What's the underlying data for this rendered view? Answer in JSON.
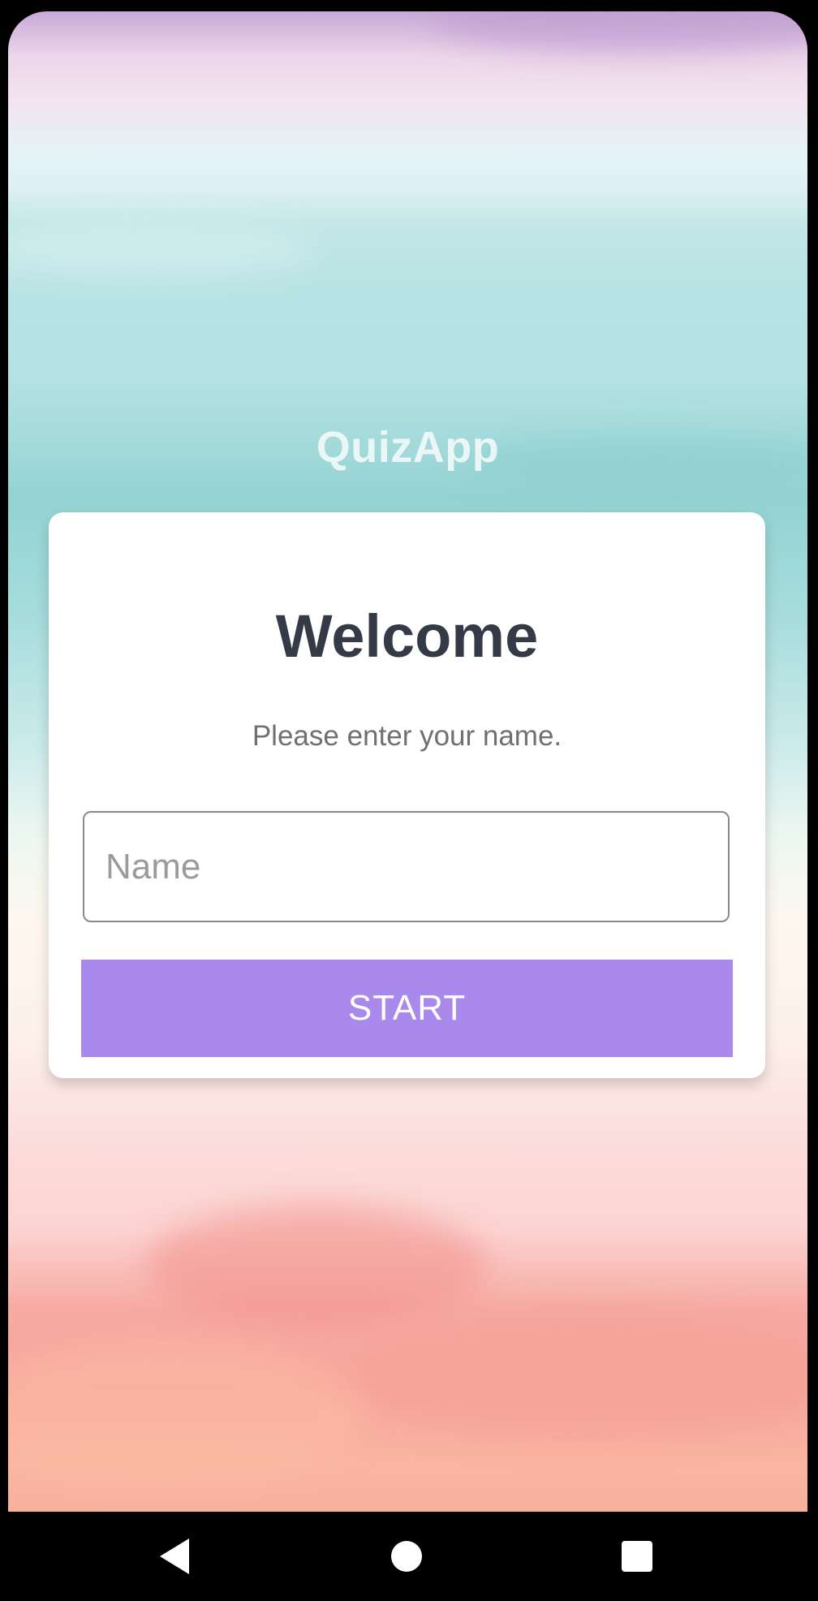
{
  "app": {
    "title": "QuizApp"
  },
  "card": {
    "heading": "Welcome",
    "subtitle": "Please enter your name."
  },
  "name_field": {
    "value": "",
    "placeholder": "Name"
  },
  "start_button": {
    "label": "START"
  },
  "colors": {
    "accent": "#aa89ec",
    "heading_text": "#343a46",
    "subtitle_text": "#707070",
    "card_background": "#ffffff",
    "nav_bar_background": "#000000"
  },
  "navigation_bar": {
    "buttons": [
      {
        "icon": "back-triangle-icon"
      },
      {
        "icon": "home-circle-icon"
      },
      {
        "icon": "recents-square-icon"
      }
    ]
  }
}
